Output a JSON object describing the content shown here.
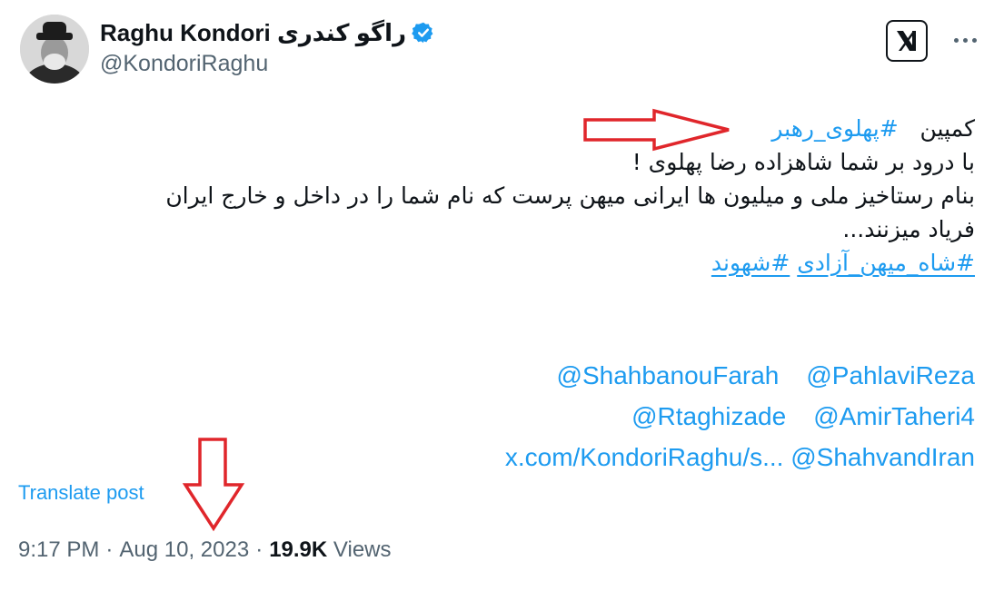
{
  "author": {
    "display_name": "Raghu Kondori راگو کندری",
    "handle": "@KondoriRaghu",
    "verified_icon": "verified-badge-icon",
    "badge_color": "#1d9bf0"
  },
  "header": {
    "logo_icon": "x-logo-icon",
    "more_icon": "more-icon"
  },
  "post": {
    "line1_word": "کمپین",
    "line1_hashtag": "#پهلوی_رهبر",
    "line2": "با درود بر شما شاهزاده رضا پهلوی !",
    "line3": "بنام رستاخیز ملی و میلیون ها ایرانی میهن پرست که نام شما را در داخل و خارج ایران",
    "line4": "فریاد میزنند...",
    "hashtag_a": "#شاه_میهن_آزادی",
    "hashtag_b": "#شهوند",
    "mentions": [
      [
        "@ShahbanouFarah",
        "@PahlaviReza"
      ],
      [
        "@Rtaghizade",
        "@AmirTaheri4"
      ],
      [
        "x.com/KondoriRaghu/s...",
        "@ShahvandIran"
      ]
    ]
  },
  "translate_label": "Translate post",
  "meta": {
    "time": "9:17 PM",
    "separator": "·",
    "date": "Aug 10, 2023",
    "views_count": "19.9K",
    "views_label": "Views"
  },
  "colors": {
    "link": "#1d9bf0",
    "secondary_text": "#536471",
    "annotation_arrow": "#e0262b"
  }
}
